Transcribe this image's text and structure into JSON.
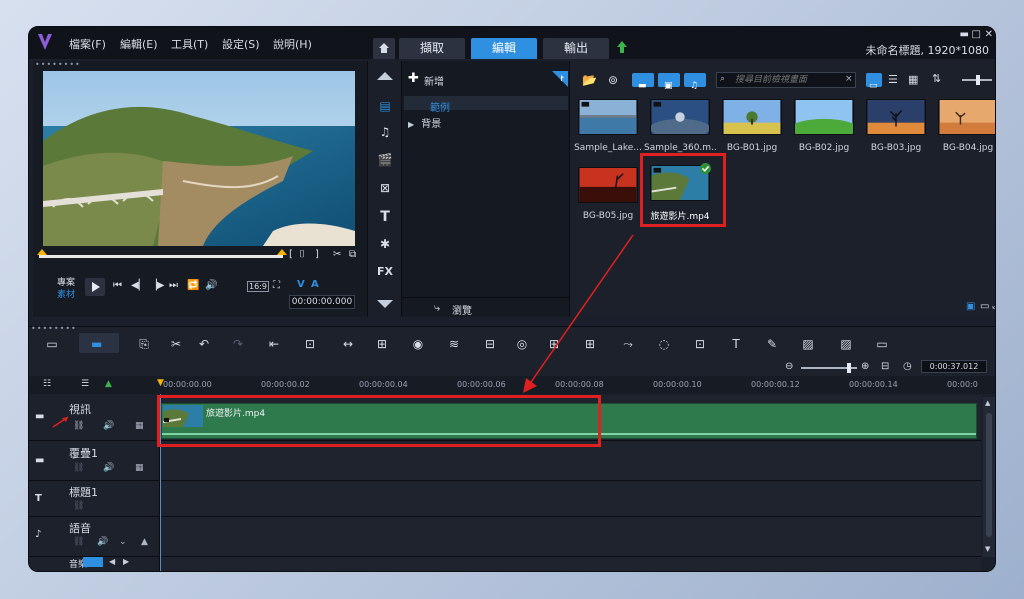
{
  "menu": [
    "檔案(F)",
    "編輯(E)",
    "工具(T)",
    "設定(S)",
    "說明(H)"
  ],
  "tabs": {
    "capture": "擷取",
    "edit": "編輯",
    "share": "輸出"
  },
  "window_title": "未命名標題, 1920*1080",
  "player": {
    "labels": {
      "project": "專案",
      "clip": "素材"
    },
    "aspect": "16:9",
    "timecode": "00:00:00.000",
    "v_label": "V",
    "a_label": "A"
  },
  "library": {
    "add_label": "新增",
    "folders": [
      "範例",
      "背景"
    ],
    "browse_label": "瀏覽",
    "search_placeholder": "搜尋目前檢視畫面",
    "fx_label": "FX",
    "items": [
      {
        "label": "Sample_Lake...",
        "thumb": "lake"
      },
      {
        "label": "Sample_360.m...",
        "thumb": "360"
      },
      {
        "label": "BG-B01.jpg",
        "thumb": "b01"
      },
      {
        "label": "BG-B02.jpg",
        "thumb": "b02"
      },
      {
        "label": "BG-B03.jpg",
        "thumb": "b03"
      },
      {
        "label": "BG-B04.jpg",
        "thumb": "b04"
      },
      {
        "label": "BG-B05.jpg",
        "thumb": "b05"
      },
      {
        "label": "旅遊影片.mp4",
        "thumb": "travel"
      }
    ]
  },
  "timeline": {
    "zoom_timecode": "0:00:37.012",
    "ticks": [
      "00:00:00.00",
      "00:00:00.02",
      "00:00:00.04",
      "00:00:00.06",
      "00:00:00.08",
      "00:00:00.10",
      "00:00:00.12",
      "00:00:00.14",
      "00:00:0"
    ],
    "tracks": [
      {
        "name": "視訊",
        "icon": "video-track-icon"
      },
      {
        "name": "覆疊1",
        "icon": "overlay-track-icon"
      },
      {
        "name": "標題1",
        "icon": "title-track-icon"
      },
      {
        "name": "語音",
        "icon": "voice-track-icon"
      },
      {
        "name": "音樂1",
        "icon": "music-track-icon"
      }
    ],
    "clip_label": "旅遊影片.mp4"
  },
  "colors": {
    "accent": "#2f8fe0",
    "highlight": "#e02020",
    "clip": "#2f7a4d"
  }
}
